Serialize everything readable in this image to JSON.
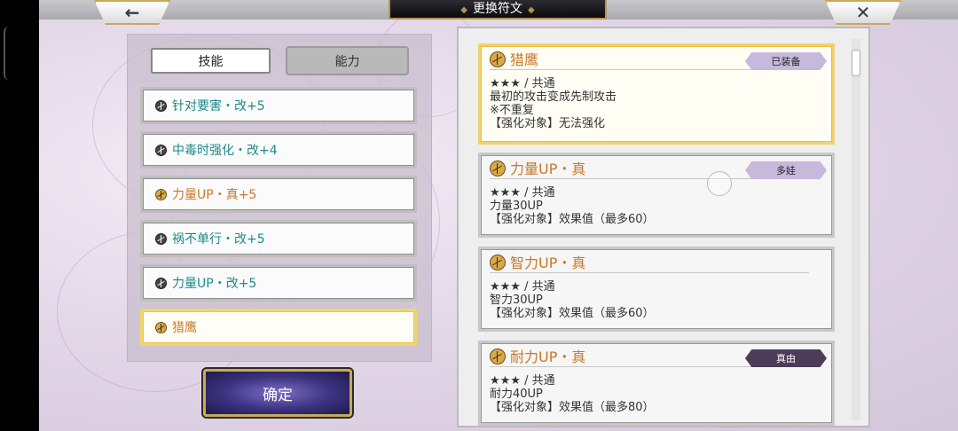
{
  "header": {
    "title": "更换符文",
    "back_icon": "←",
    "close_icon": "✕"
  },
  "tabs": [
    {
      "label": "技能",
      "active": true
    },
    {
      "label": "能力",
      "active": false
    }
  ],
  "skills": [
    {
      "label": "针对要害・改+5",
      "icon": "rune-dark",
      "color": "#1e8a8a"
    },
    {
      "label": "中毒时强化・改+4",
      "icon": "rune-dark",
      "color": "#1e8a8a"
    },
    {
      "label": "力量UP・真+5",
      "icon": "rune-gold",
      "color": "#c8782a"
    },
    {
      "label": "祸不单行・改+5",
      "icon": "rune-dark",
      "color": "#1e8a8a"
    },
    {
      "label": "力量UP・改+5",
      "icon": "rune-dark",
      "color": "#1e8a8a"
    },
    {
      "label": "猎鹰",
      "icon": "rune-gold",
      "color": "#c8782a",
      "selected": true
    }
  ],
  "confirm_label": "确定",
  "runes": [
    {
      "name": "猎鹰",
      "badge": "已装备",
      "badge_style": "light",
      "lines": [
        "★★★ / 共通",
        "最初的攻击变成先制攻击",
        "※不重复",
        "【强化对象】无法强化"
      ],
      "equipped": true
    },
    {
      "name": "力量UP・真",
      "badge": "多娃",
      "badge_style": "light",
      "lines": [
        "★★★ / 共通",
        "力量30UP",
        "【强化对象】效果值（最多60）"
      ]
    },
    {
      "name": "智力UP・真",
      "badge": "",
      "lines": [
        "★★★ / 共通",
        "智力30UP",
        "【强化对象】效果值（最多60）"
      ]
    },
    {
      "name": "耐力UP・真",
      "badge": "真由",
      "badge_style": "dark",
      "lines": [
        "★★★ / 共通",
        "耐力40UP",
        "【强化对象】效果值（最多80）"
      ]
    }
  ]
}
